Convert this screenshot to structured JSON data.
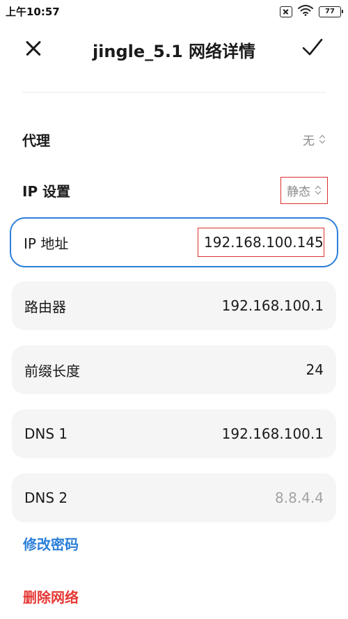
{
  "status_bar": {
    "time": "上午10:57",
    "battery": "77",
    "icons": [
      "sim-off-icon",
      "wifi-icon",
      "battery-icon"
    ]
  },
  "header": {
    "title": "jingle_5.1 网络详情",
    "close_icon": "close-icon",
    "confirm_icon": "check-icon"
  },
  "settings": {
    "proxy": {
      "label": "代理",
      "value": "无"
    },
    "ip_settings": {
      "label": "IP 设置",
      "value": "静态"
    }
  },
  "fields": [
    {
      "label": "IP 地址",
      "value": "192.168.100.145"
    },
    {
      "label": "路由器",
      "value": "192.168.100.1"
    },
    {
      "label": "前缀长度",
      "value": "24"
    },
    {
      "label": "DNS 1",
      "value": "192.168.100.1"
    },
    {
      "label": "DNS 2",
      "value": "8.8.4.4"
    }
  ],
  "actions": {
    "modify_password": "修改密码",
    "delete_network": "删除网络"
  },
  "colors": {
    "accent": "#2b7fd9",
    "danger": "#e53935",
    "annotation": "#d9302c"
  }
}
